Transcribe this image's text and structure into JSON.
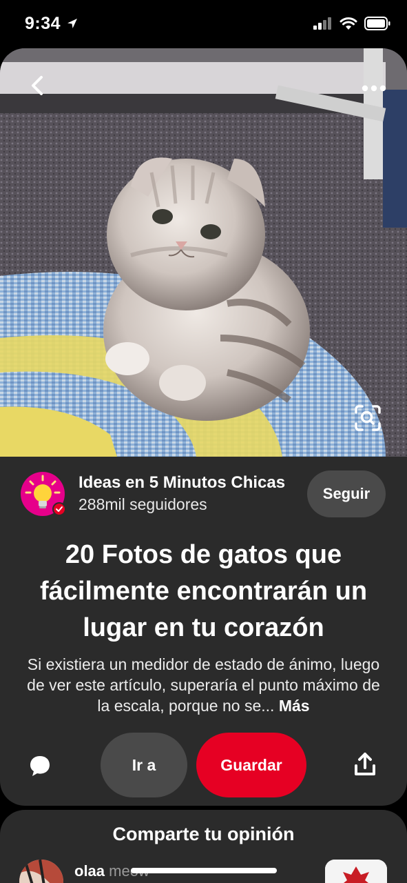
{
  "status_bar": {
    "time": "9:34",
    "icons": [
      "location-arrow-icon",
      "cellular-signal-icon",
      "wifi-icon",
      "battery-icon"
    ]
  },
  "pin": {
    "image_icons": [
      "back-chevron-icon",
      "more-options-icon",
      "visual-search-icon"
    ],
    "creator": {
      "name": "Ideas en 5 Minutos Chicas",
      "followers": "288mil seguidores",
      "follow_label": "Seguir",
      "avatar_icon": "lightbulb-icon",
      "verified_icon": "verified-check-icon"
    },
    "title": "20 Fotos de gatos que fácilmente encontrarán un lugar en tu corazón",
    "description": "Si existiera un medidor de estado de ánimo, luego de ver este artículo, superaría el punto máximo de la escala, porque no se...",
    "more_label": "Más",
    "actions": {
      "comment_icon": "comment-bubble-icon",
      "visit_label": "Ir a",
      "save_label": "Guardar",
      "share_icon": "share-upload-icon"
    }
  },
  "opinion": {
    "title": "Comparte tu opinión",
    "comment": {
      "author": "olaa",
      "text": "meow"
    }
  },
  "colors": {
    "background": "#000000",
    "card": "#2b2b2b",
    "secondary_button": "#4a4a4a",
    "save_button": "#e60023",
    "avatar": "#e6008a"
  }
}
